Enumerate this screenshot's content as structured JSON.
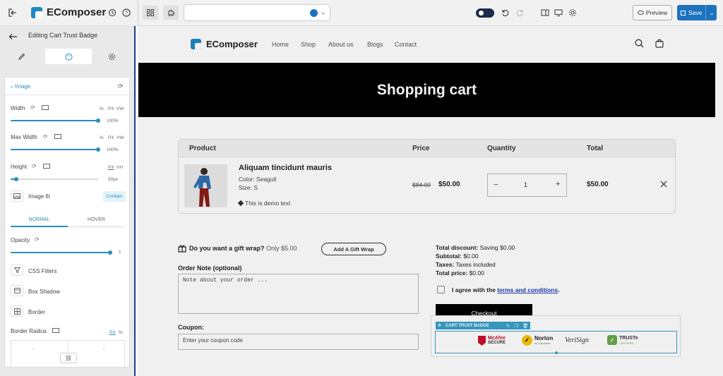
{
  "app": {
    "name": "EComposer"
  },
  "toolbar": {
    "preview_label": "Preview",
    "save_label": "Save"
  },
  "sidebar": {
    "title": "Editing Cart Trust Badge",
    "section_label": "Image",
    "width": {
      "label": "Width",
      "unit_px": "PX",
      "unit_vw": "VW",
      "value": "100%",
      "fraction": 1.0
    },
    "max_width": {
      "label": "Max Width",
      "unit_px": "PX",
      "unit_vw": "VW",
      "value": "100%",
      "fraction": 1.0
    },
    "height": {
      "label": "Height",
      "unit_px": "PX",
      "unit_vh": "VH",
      "value": "50px",
      "fraction": 0.06
    },
    "image_fit": {
      "label": "Image fit",
      "value": "Contain"
    },
    "tabs": [
      "NORMAL",
      "HOVER"
    ],
    "opacity": {
      "label": "Opacity",
      "value": "1",
      "fraction": 1.0
    },
    "options": [
      "CSS Filters",
      "Box Shadow",
      "Border"
    ],
    "border_radius": {
      "label": "Border Radius",
      "unit_px": "PX",
      "unit_pct": "%",
      "values": [
        "-",
        "-",
        "-",
        "-"
      ]
    }
  },
  "site": {
    "brand": "EComposer",
    "nav": [
      "Home",
      "Shop",
      "About us",
      "Blogs",
      "Contact"
    ],
    "hero_title": "Shopping cart",
    "table_headers": [
      "Product",
      "Price",
      "Quantity",
      "Total"
    ],
    "product": {
      "name": "Aliquam tincidunt mauris",
      "color": "Color: Seagull",
      "size": "Size: S",
      "note": "This is demo text",
      "old_price": "$84.00",
      "price": "$50.00",
      "qty": "1",
      "qty_minus": "−",
      "qty_plus": "+",
      "total": "$50.00"
    },
    "gift": {
      "question": "Do you want a gift wrap?",
      "price": "Only $5.00",
      "button": "Add A Gift Wrap"
    },
    "order_note": {
      "label": "Order Note (optional)",
      "placeholder": "Note about your order ..."
    },
    "coupon": {
      "label": "Coupon:",
      "placeholder": "Enter your coupon code"
    },
    "summary": {
      "discount_label": "Total discount:",
      "discount_value": "Saving $0.00",
      "subtotal_label": "Subtotal:",
      "subtotal_value": "$0.00",
      "taxes_label": "Taxes:",
      "taxes_value": "Taxes included",
      "total_label": "Total price:",
      "total_value": "$0.00"
    },
    "terms": {
      "prefix": "I agree with the ",
      "link": "terms and conditions",
      "suffix": "."
    },
    "checkout_label": "Checkout",
    "badge_toolbar_label": "CART TRUST BADGE",
    "badges": {
      "mcafee_top": "McAfee",
      "mcafee_bottom": "SECURE",
      "norton": "Norton",
      "norton_sub": "by Symantec",
      "verisign": "VeriSign",
      "truste": "TRUSTe",
      "truste_sub": "CERTIFIED"
    }
  },
  "colors": {
    "accent": "#2a8fbd",
    "save": "#1e73be",
    "hero_bg": "#000000",
    "link": "#1a3fb3",
    "badge_border": "#3aa0c9"
  }
}
